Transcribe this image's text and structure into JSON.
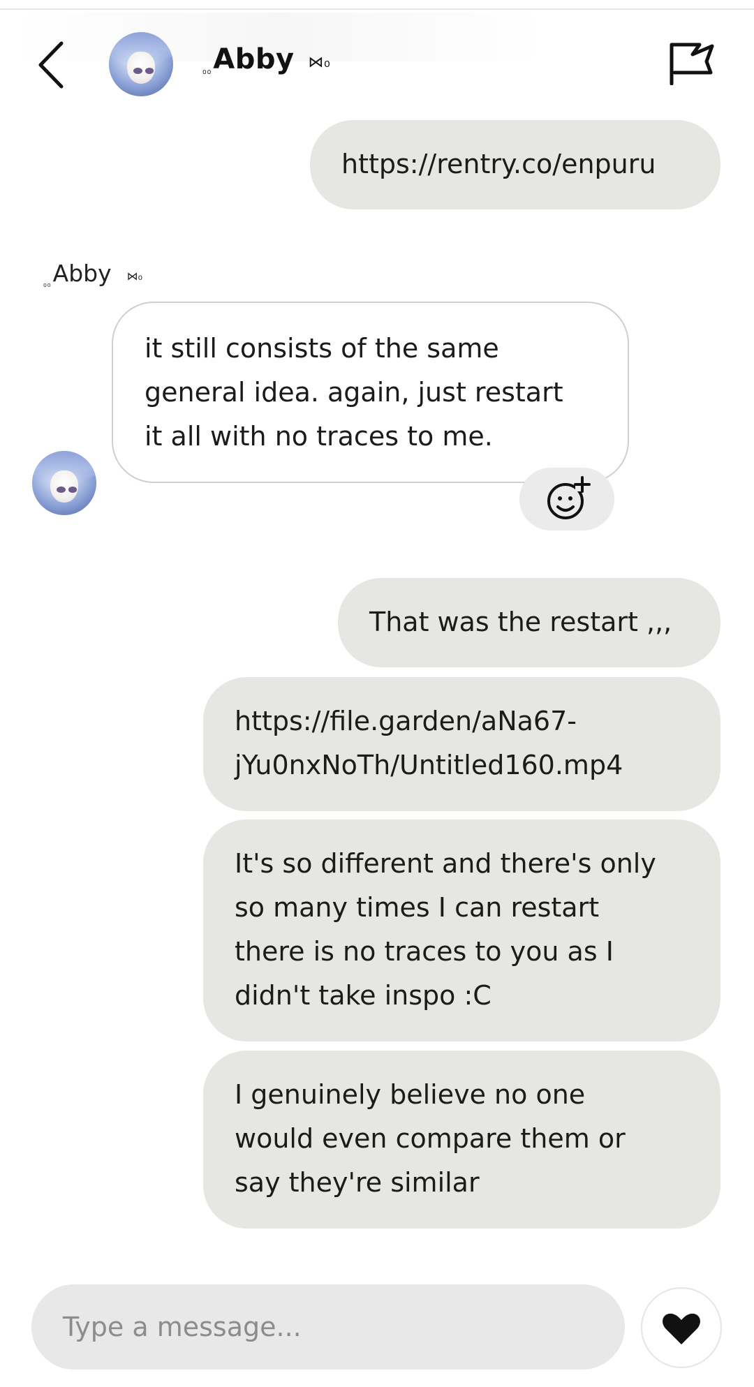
{
  "header": {
    "contact_prefix": "₀₀",
    "contact_name": "Abby",
    "contact_suffix": "⋈₀",
    "back_icon": "chevron-left-icon",
    "report_icon": "flag-icon"
  },
  "messages": [
    {
      "side": "out",
      "lines": [
        "https://rentry.co/enpuru"
      ]
    },
    {
      "side": "in",
      "sender_prefix": "₀₀",
      "sender": "Abby",
      "sender_suffix": "⋈₀",
      "lines": [
        "it still consists of the same",
        "general idea. again, just restart",
        "it all with no traces to me."
      ]
    },
    {
      "side": "out",
      "lines": [
        "That was the restart ,,,"
      ]
    },
    {
      "side": "out",
      "lines": [
        "https://file.garden/aNa67-",
        "jYu0nxNoTh/Untitled160.mp4"
      ]
    },
    {
      "side": "out",
      "lines": [
        "It's so different and there's only",
        "so many times I can restart",
        "there is no traces to you as I",
        "didn't take inspo :C"
      ]
    },
    {
      "side": "out",
      "lines": [
        "I genuinely believe no one",
        "would even compare them or",
        "say they're similar"
      ]
    }
  ],
  "reaction_icon": "add-emoji-icon",
  "composer": {
    "placeholder": "Type a message...",
    "send_icon": "heart-icon"
  },
  "colors": {
    "outgoing_bubble": "#e6e6e2",
    "incoming_border": "#cfcfcf",
    "input_bg": "#e8e8e8"
  }
}
